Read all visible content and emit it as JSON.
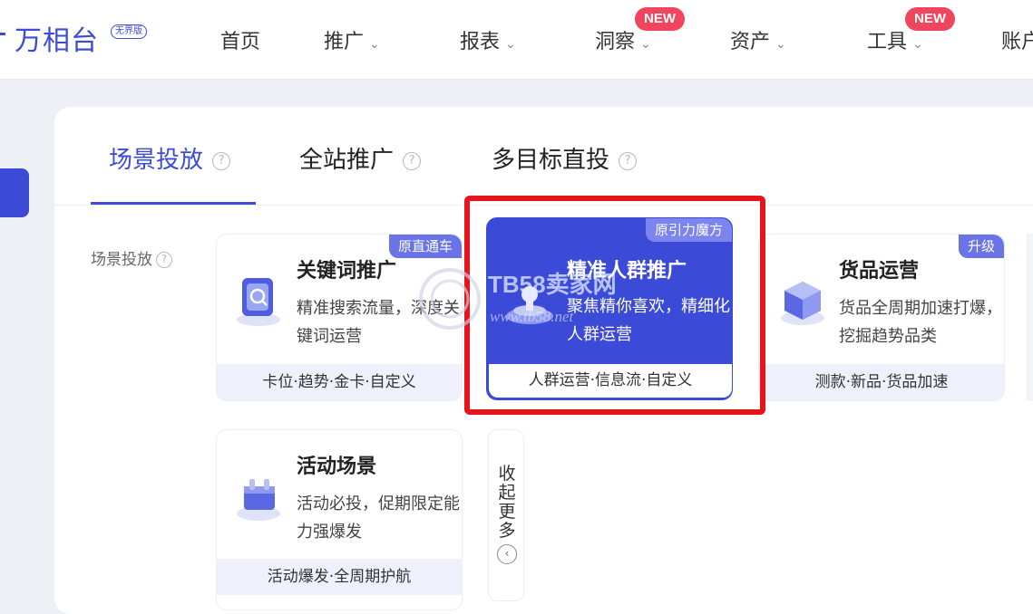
{
  "logo": {
    "text": "万相台",
    "badge": "无界版"
  },
  "nav": {
    "items": [
      {
        "label": "首页",
        "chevron": false
      },
      {
        "label": "推广",
        "chevron": true
      },
      {
        "label": "报表",
        "chevron": true
      },
      {
        "label": "洞察",
        "chevron": true,
        "badge": "NEW"
      },
      {
        "label": "资产",
        "chevron": true
      },
      {
        "label": "工具",
        "chevron": true,
        "badge": "NEW"
      },
      {
        "label": "账户",
        "chevron": false
      }
    ]
  },
  "tabs": [
    {
      "label": "场景投放",
      "active": true,
      "help": "?"
    },
    {
      "label": "全站推广",
      "active": false,
      "help": "?"
    },
    {
      "label": "多目标直投",
      "active": false,
      "help": "?"
    }
  ],
  "section_label": "场景投放",
  "cards": [
    {
      "title": "关键词推广",
      "desc": "精准搜索流量，深度关键词运营",
      "footer": "卡位·趋势·金卡·自定义",
      "tag": "原直通车",
      "icon": "keyword-icon",
      "featured": false
    },
    {
      "title": "精准人群推广",
      "desc": "聚焦精你喜欢，精细化人群运营",
      "footer": "人群运营·信息流·自定义",
      "tag": "原引力魔方",
      "icon": "crowd-icon",
      "featured": true
    },
    {
      "title": "货品运营",
      "desc": "货品全周期加速打爆，挖掘趋势品类",
      "footer": "测款·新品·货品加速",
      "tag": "升级",
      "icon": "goods-icon",
      "featured": false
    },
    {
      "title": "活动场景",
      "desc": "活动必投，促期限定能力强爆发",
      "footer": "活动爆发·全周期护航",
      "tag": "",
      "icon": "event-icon",
      "featured": false
    }
  ],
  "collapse": {
    "label": "收起更多",
    "icon": "chevron-left-icon"
  },
  "watermark": {
    "line1": "TB58卖家网",
    "line2": "www.tb58.net"
  },
  "colors": {
    "accent": "#3b4bd8",
    "badge_red": "#f0455c",
    "highlight": "#e8141c"
  }
}
